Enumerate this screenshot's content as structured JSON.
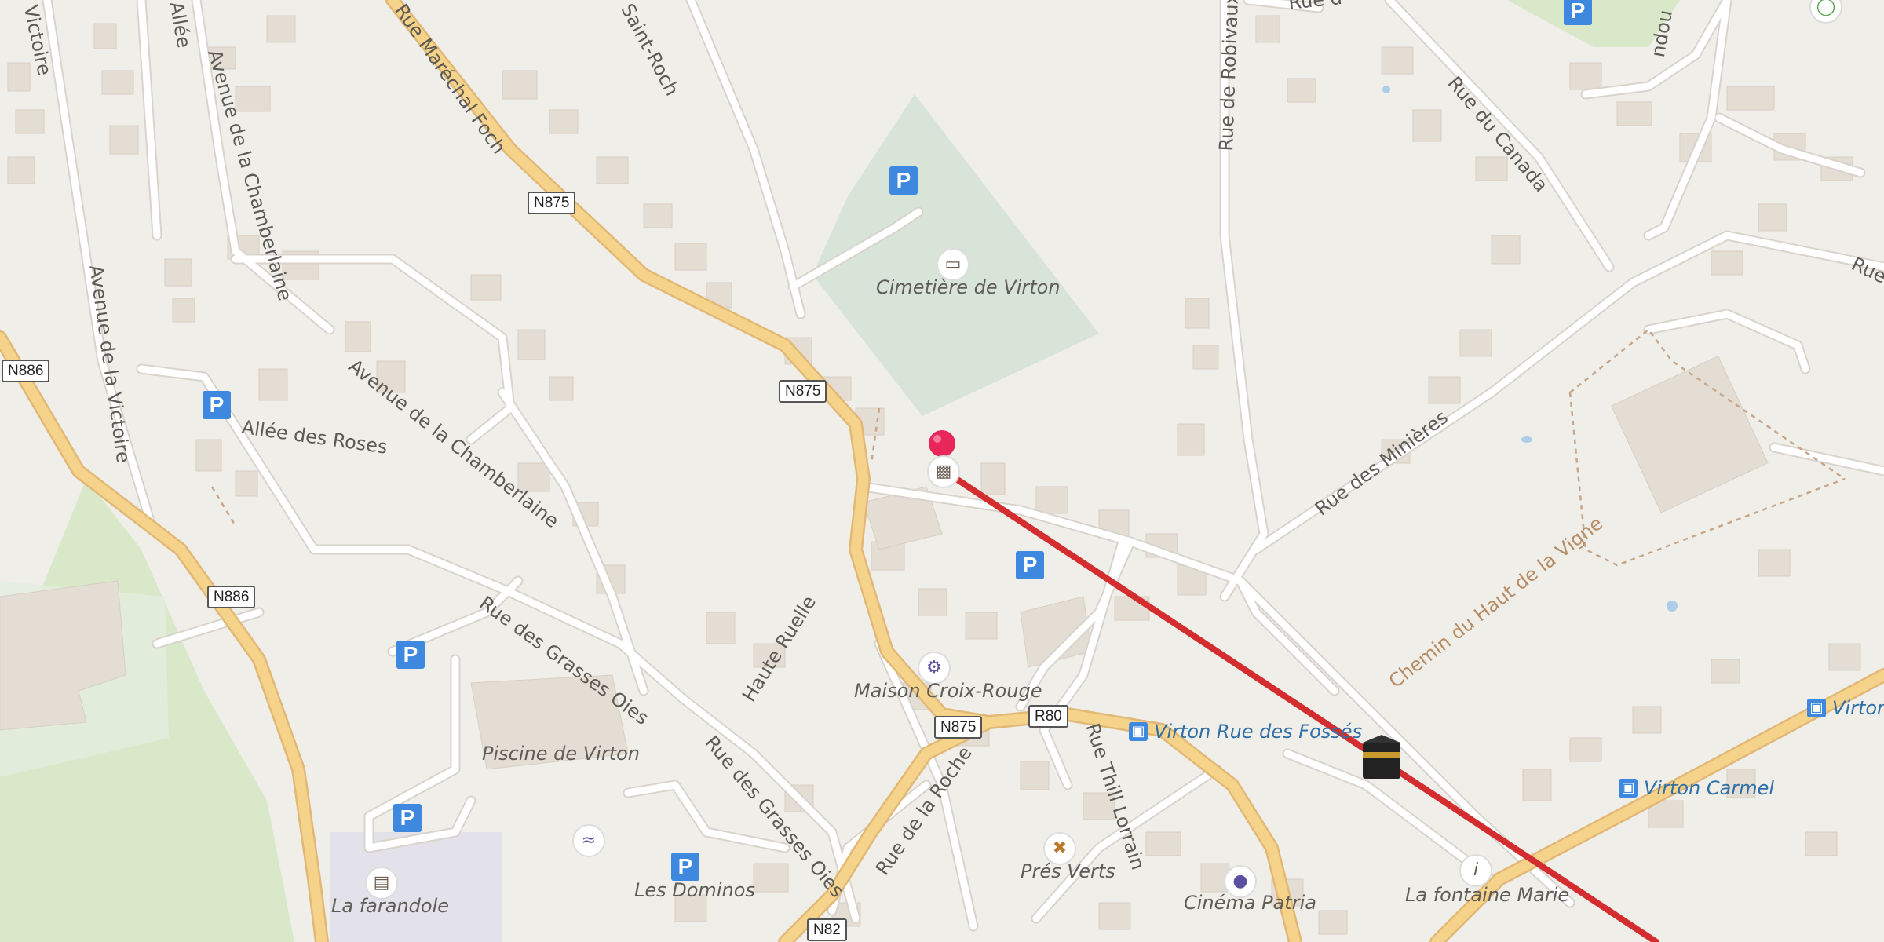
{
  "streets": {
    "allee_victoire": "Victoire",
    "allee_top": "Allée",
    "rue_marechal_foch": "Rue Maréchal Foch",
    "saint_roch": "Saint-Roch",
    "rue_de_robivaux": "Rue de Robivaux",
    "rue_a": "Rue d",
    "rue_du_canada": "Rue du Canada",
    "avenue_chamberlaine_v": "Avenue de la Chamberlaine",
    "avenue_victoire": "Avenue de la Victoire",
    "avenue_chamberlaine": "Avenue de la Chamberlaine",
    "allee_des_roses": "Allée des Roses",
    "rue_des_minieres": "Rue des Minières",
    "chemin_haut_vigne": "Chemin du Haut de la Vigne",
    "rue_des_grasses_oies_1": "Rue des Grasses Oies",
    "rue_des_grasses_oies_2": "Rue des Grasses Oies",
    "haute_ruelle": "Haute Ruelle",
    "rue_de_la_roche": "Rue de la Roche",
    "rue_thill_lorrain": "Rue Thill Lorrain",
    "rue_right": "Rue",
    "rue_top_right": "ndou"
  },
  "road_shields": [
    "N875",
    "N875",
    "N886",
    "N886",
    "N875",
    "R80",
    "N82"
  ],
  "places": {
    "cimetiere": "Cimetière de Virton",
    "maison_croix_rouge": "Maison Croix-Rouge",
    "piscine": "Piscine de Virton",
    "les_dominos": "Les Dominos",
    "la_farandole": "La farandole",
    "pres_verts": "Prés Verts",
    "cinema_patria": "Cinéma Patria",
    "la_fontaine_marie": "La fontaine Marie"
  },
  "bus_stops": {
    "rue_des_fosses": "Virton Rue des Fossés",
    "carmel": "Virton Carmel",
    "virton_right": "Virton"
  },
  "parking_label": "P",
  "icons": {
    "cemetery": "cemetery-icon",
    "factory": "factory-icon",
    "clothes": "clothes-shop-icon",
    "restaurant": "restaurant-icon",
    "cinema": "cinema-icon",
    "info": "information-icon",
    "swim": "swimming-icon",
    "library": "library-icon",
    "kaaba": "place-of-worship-icon",
    "marker": "location-marker-icon"
  },
  "colors": {
    "background": "#efeee9",
    "minor_road": "#ffffff",
    "major_road": "#f6d38a",
    "building": "#e4ddd3",
    "cemetery": "#d9e4d8",
    "park": "#d8e8c8",
    "route_line": "#d42d30",
    "parking": "#3f88e0",
    "marker": "#e8265a"
  }
}
